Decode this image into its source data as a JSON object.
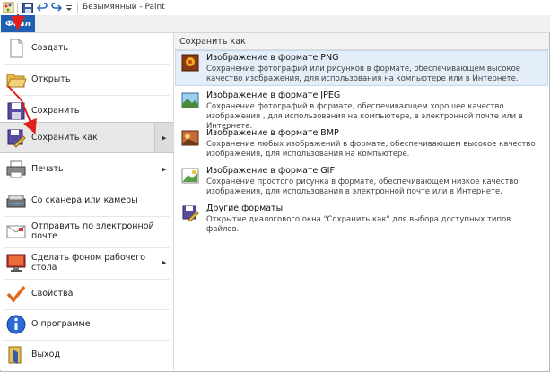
{
  "window": {
    "title": "Безымянный - Paint"
  },
  "ribbon": {
    "file_tab": "Файл"
  },
  "menu": {
    "items": [
      {
        "label": "Создать",
        "icon": "new-file-icon",
        "has_submenu": false
      },
      {
        "label": "Открыть",
        "icon": "open-folder-icon",
        "has_submenu": false
      },
      {
        "label": "Сохранить",
        "icon": "save-disk-icon",
        "has_submenu": false
      },
      {
        "label": "Сохранить как",
        "icon": "save-as-icon",
        "has_submenu": true
      },
      {
        "label": "Печать",
        "icon": "printer-icon",
        "has_submenu": true
      },
      {
        "label": "Со сканера или камеры",
        "icon": "scanner-icon",
        "has_submenu": false
      },
      {
        "label": "Отправить по электронной почте",
        "icon": "email-icon",
        "has_submenu": false
      },
      {
        "label": "Сделать фоном рабочего стола",
        "icon": "desktop-background-icon",
        "has_submenu": true
      },
      {
        "label": "Свойства",
        "icon": "checkmark-icon",
        "has_submenu": false
      },
      {
        "label": "О программе",
        "icon": "info-icon",
        "has_submenu": false
      },
      {
        "label": "Выход",
        "icon": "exit-icon",
        "has_submenu": false
      }
    ]
  },
  "save_as_panel": {
    "heading": "Сохранить как",
    "options": [
      {
        "title": "Изображение в формате PNG",
        "desc": "Сохранение фотографий или рисунков в формате, обеспечивающем высокое качество изображения, для использования на компьютере или в Интернете.",
        "icon": "png-image-icon"
      },
      {
        "title": "Изображение в формате JPEG",
        "desc": "Сохранение фотографий в формате, обеспечивающем хорошее качество изображения , для использования на компьютере, в электронной почте или в Интернете.",
        "icon": "jpeg-image-icon"
      },
      {
        "title": "Изображение в формате BMP",
        "desc": "Сохранение любых изображений в формате, обеспечивающем высокое качество изображения, для использования на компьютере.",
        "icon": "bmp-image-icon"
      },
      {
        "title": "Изображение в формате GIF",
        "desc": "Сохранение простого рисунка в формате, обеспечивающем низкое качество изображения, для использования в электронной почте или в Интернете.",
        "icon": "gif-image-icon"
      },
      {
        "title": "Другие форматы",
        "desc": "Открытие диалогового окна \"Сохранить как\" для выбора доступных типов файлов.",
        "icon": "other-formats-icon"
      }
    ]
  },
  "colors": {
    "accent": "#1f5fb3",
    "annotation": "#e0201c",
    "highlight": "#e4eef8"
  }
}
